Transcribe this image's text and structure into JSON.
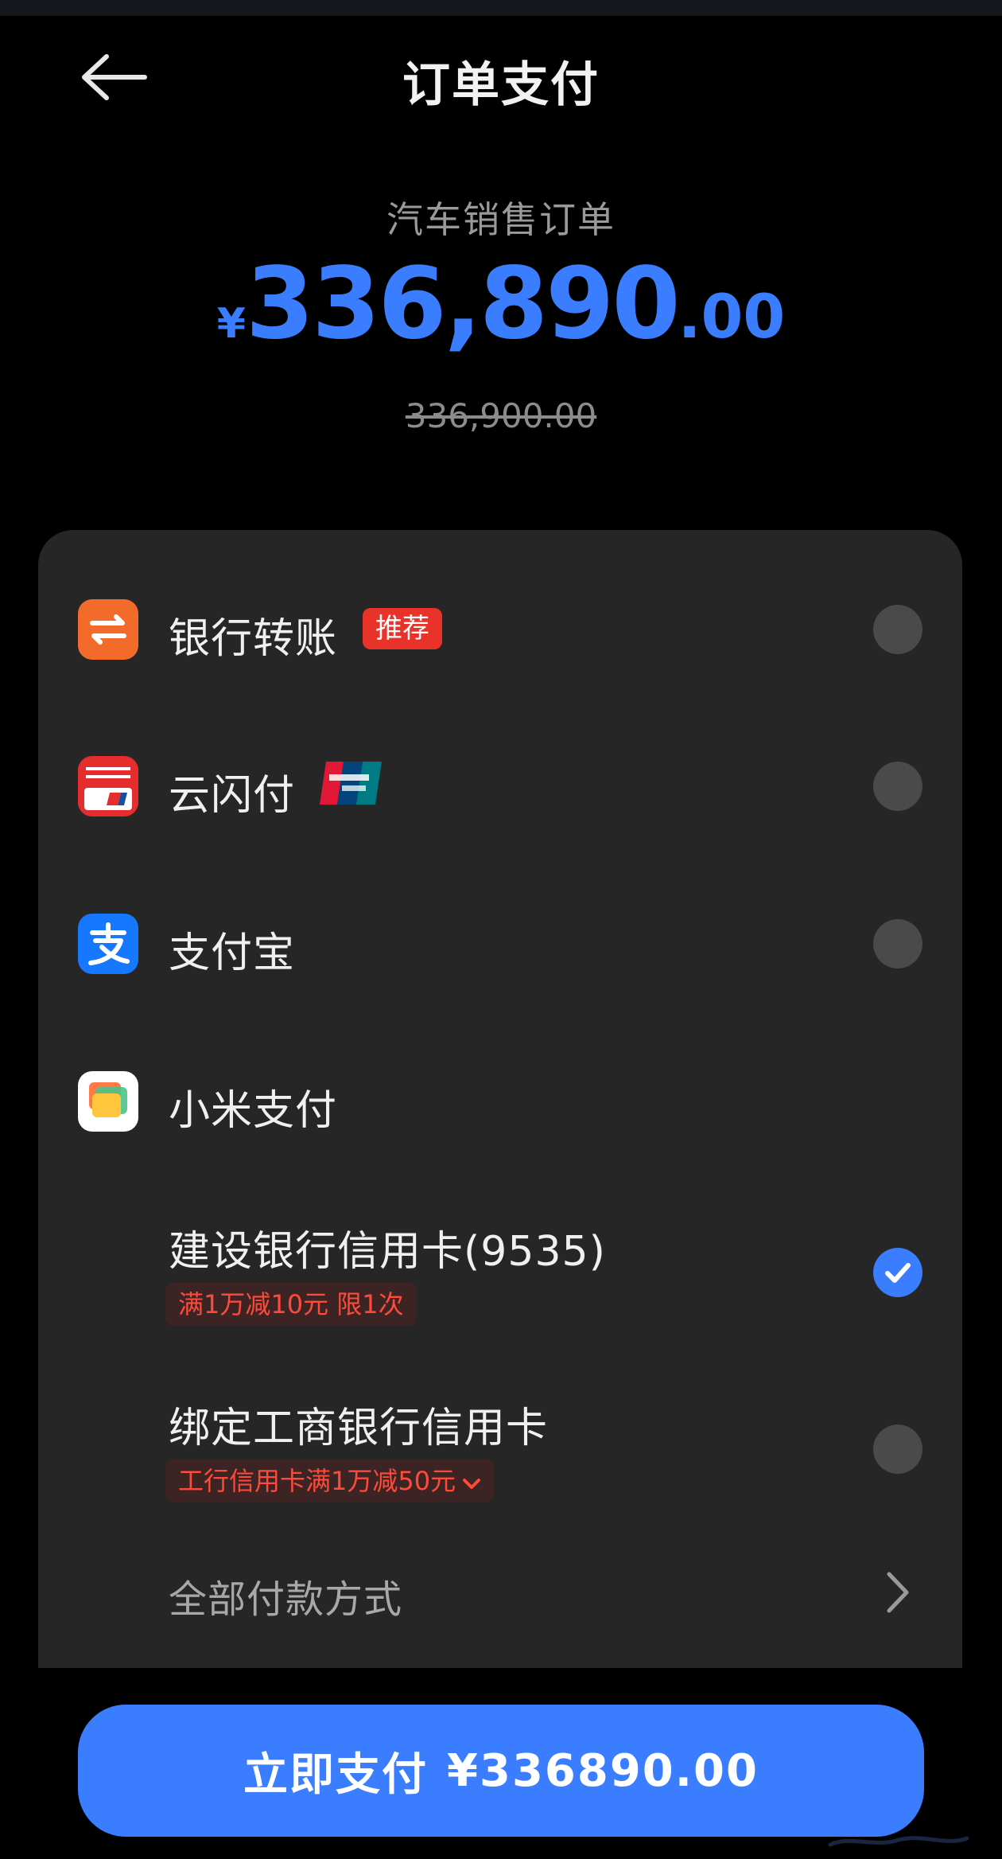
{
  "header": {
    "title": "订单支付",
    "back_icon": "arrow-left-icon"
  },
  "order": {
    "label": "汽车销售订单",
    "currency": "¥",
    "amount_int": "336,890",
    "amount_dec": ".00",
    "original_amount": "336,900.00"
  },
  "methods": [
    {
      "label": "银行转账",
      "badge": "推荐",
      "icon": "bank-transfer-icon",
      "selected": false
    },
    {
      "label": "云闪付",
      "icon": "yunshanfu-icon",
      "tag_icon": "unionpay-logo-icon",
      "selected": false
    },
    {
      "label": "支付宝",
      "icon": "alipay-icon",
      "selected": false
    },
    {
      "label": "小米支付",
      "icon": "mi-pay-icon"
    }
  ],
  "mipay_options": [
    {
      "label": "建设银行信用卡(9535)",
      "promo": "满1万减10元  限1次",
      "selected": true
    },
    {
      "label": "绑定工商银行信用卡",
      "promo": "工行信用卡满1万减50元",
      "has_dropdown": true,
      "selected": false
    }
  ],
  "all_methods": {
    "label": "全部付款方式",
    "icon": "chevron-right-icon"
  },
  "pay_button": {
    "label": "立即支付",
    "price": "¥336890.00"
  },
  "colors": {
    "accent": "#3a7dff",
    "badge_red": "#e8322a",
    "promo_text": "#ff4a3a",
    "card_bg": "#262626"
  }
}
